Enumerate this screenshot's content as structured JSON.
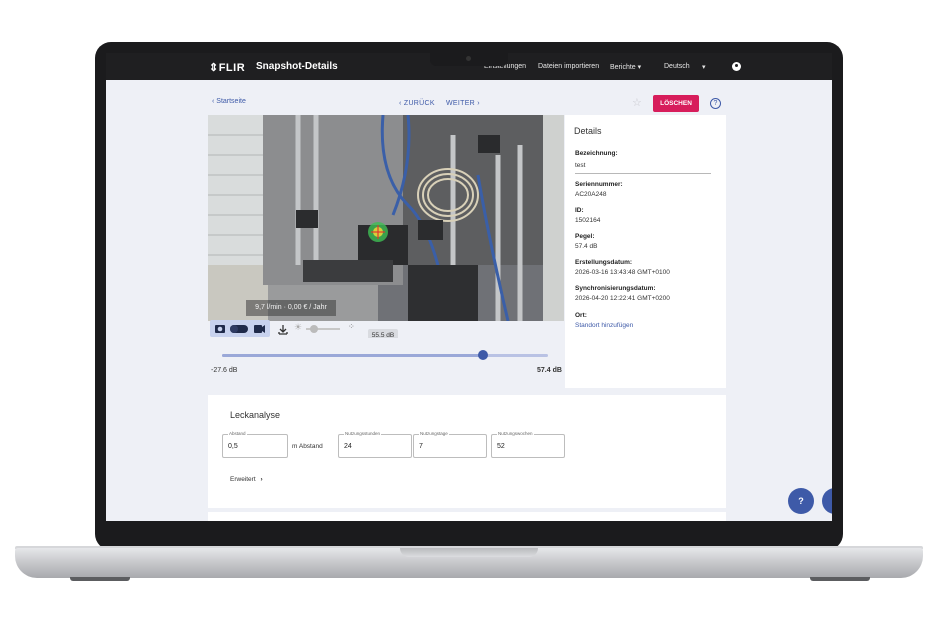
{
  "header": {
    "logo": "⇕FLIR",
    "title": "Snapshot-Details",
    "nav": [
      "Einstellungen",
      "Dateien importieren",
      "Berichte ▾",
      "Deutsch",
      "▾"
    ]
  },
  "toolbar": {
    "back_label": "‹ Startseite",
    "prev_label": "‹ ZURÜCK",
    "next_label": "WEITER ›",
    "delete_label": "LÖSCHEN",
    "help_label": "?"
  },
  "image": {
    "flow_rate": "9,7 l/min",
    "cost": "0,00 € / Jahr"
  },
  "level_slider": {
    "current": "55.5 dB",
    "min": "-27.6 dB",
    "max": "57.4 dB",
    "fraction": 0.8
  },
  "details": {
    "title": "Details",
    "fields": [
      {
        "label": "Bezeichnung:",
        "value": "test"
      },
      {
        "label": "Seriennummer:",
        "value": "AC20A248"
      },
      {
        "label": "ID:",
        "value": "1502164"
      },
      {
        "label": "Pegel:",
        "value": "57.4 dB"
      },
      {
        "label": "Erstellungsdatum:",
        "value": "2026-03-16 13:43:48 GMT+0100"
      },
      {
        "label": "Synchronisierungsdatum:",
        "value": "2026-04-20 12:22:41 GMT+0200"
      },
      {
        "label": "Ort:",
        "value": "Standort hinzufügen"
      }
    ]
  },
  "leak_analysis": {
    "title": "Leckanalyse",
    "distance": {
      "label": "Abstand",
      "value": "0,5",
      "unit": "m Abstand"
    },
    "hours": {
      "label": "Nutzungsstunden",
      "value": "24"
    },
    "days": {
      "label": "Nutzungstage",
      "value": "7"
    },
    "weeks": {
      "label": "Nutzungswochen",
      "value": "52"
    },
    "advanced_label": "Erweitert"
  },
  "fab": {
    "help": "?",
    "menu": "⋮"
  },
  "colors": {
    "accent": "#3e5aa8",
    "delete": "#d71d5b",
    "header": "#1f1f21"
  }
}
